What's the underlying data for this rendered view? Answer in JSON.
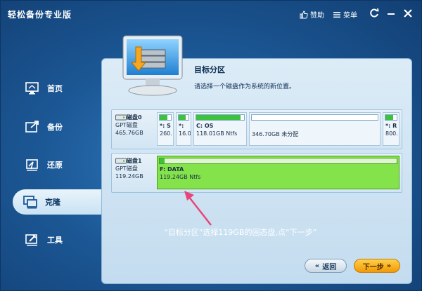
{
  "app": {
    "title": "轻松备份专业版",
    "donate_label": "赞助",
    "menu_label": "菜单"
  },
  "sidebar": {
    "items": [
      {
        "label": "首页"
      },
      {
        "label": "备份"
      },
      {
        "label": "还原"
      },
      {
        "label": "克隆"
      },
      {
        "label": "工具"
      }
    ]
  },
  "main": {
    "title": "目标分区",
    "subtitle": "请选择一个磁盘作为系统的新位置。",
    "disks": [
      {
        "name": "磁盘0",
        "type": "GPT磁盘",
        "size": "465.76GB",
        "partitions": [
          {
            "label": "*: S",
            "detail": "260."
          },
          {
            "label": "*:",
            "detail": "16.0"
          },
          {
            "label": "C: OS",
            "detail": "118.01GB Ntfs"
          },
          {
            "label": "",
            "detail": "346.70GB 未分配"
          },
          {
            "label": "*: R",
            "detail": "800."
          }
        ]
      },
      {
        "name": "磁盘1",
        "type": "GPT磁盘",
        "size": "119.24GB",
        "partitions": [
          {
            "label": "F: DATA",
            "detail": "119.24GB Ntfs"
          }
        ]
      }
    ],
    "annotation": "“目标分区”选择119GB的固态盘,点“下一步”"
  },
  "footer": {
    "back_label": "返回",
    "next_label": "下一步"
  },
  "colors": {
    "accent": "#2f79bf",
    "selected_partition": "#84e24a",
    "next_button": "#f29a05",
    "arrow": "#e8457a"
  }
}
